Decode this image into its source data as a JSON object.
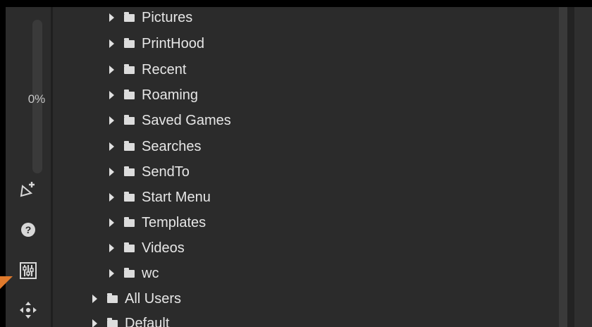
{
  "sidebar": {
    "progress_label": "0%",
    "progress_value": 0,
    "icons": [
      {
        "name": "add-tag-icon",
        "glyph": "add-tag"
      },
      {
        "name": "help-icon",
        "glyph": "?"
      },
      {
        "name": "equalizer-settings-icon",
        "glyph": "equalizer"
      },
      {
        "name": "move-icon",
        "glyph": "move"
      }
    ]
  },
  "tree": {
    "items": [
      {
        "label": "Pictures",
        "level": 2
      },
      {
        "label": "PrintHood",
        "level": 2
      },
      {
        "label": "Recent",
        "level": 2
      },
      {
        "label": "Roaming",
        "level": 2
      },
      {
        "label": "Saved Games",
        "level": 2
      },
      {
        "label": "Searches",
        "level": 2
      },
      {
        "label": "SendTo",
        "level": 2
      },
      {
        "label": "Start Menu",
        "level": 2
      },
      {
        "label": "Templates",
        "level": 2
      },
      {
        "label": "Videos",
        "level": 2
      },
      {
        "label": "wc",
        "level": 2
      },
      {
        "label": "All Users",
        "level": 1
      },
      {
        "label": "Default",
        "level": 1
      }
    ]
  },
  "colors": {
    "accent": "#e07a2c",
    "panel_bg": "#2b2b2b",
    "text": "#e6e6e6"
  }
}
